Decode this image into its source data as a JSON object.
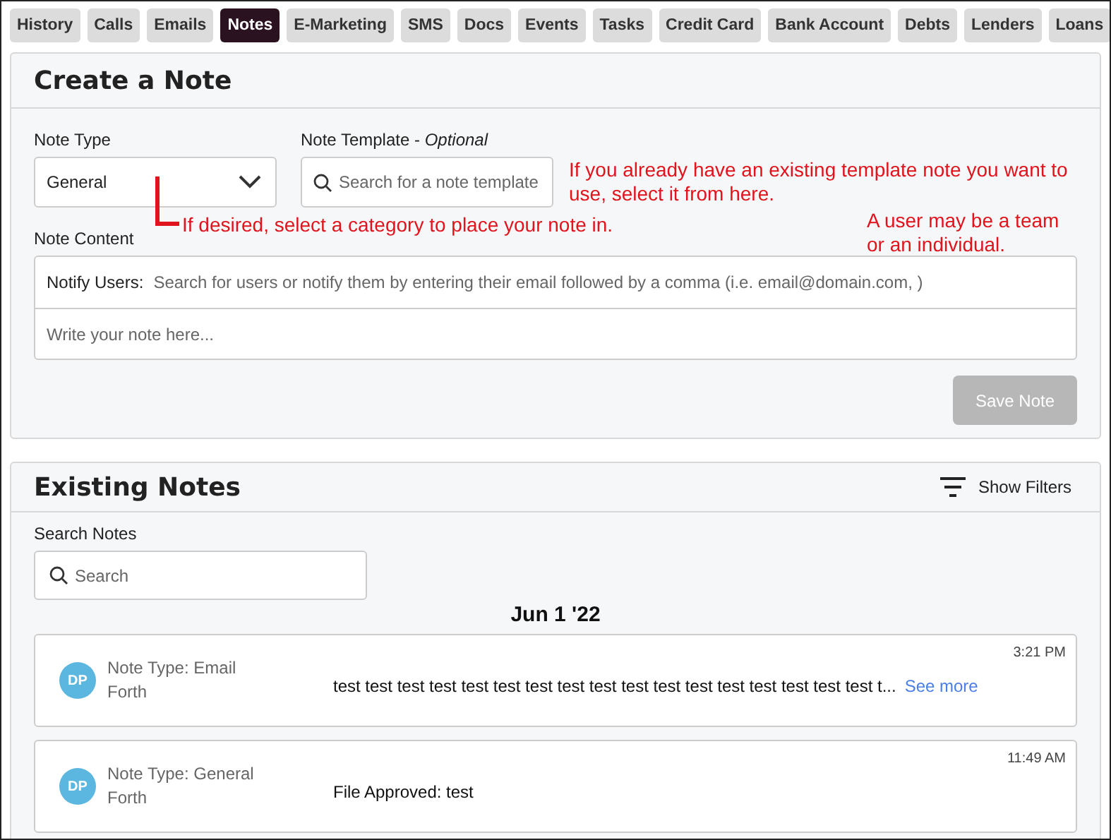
{
  "tabs": [
    {
      "label": "History",
      "selected": false
    },
    {
      "label": "Calls",
      "selected": false
    },
    {
      "label": "Emails",
      "selected": false
    },
    {
      "label": "Notes",
      "selected": true
    },
    {
      "label": "E-Marketing",
      "selected": false
    },
    {
      "label": "SMS",
      "selected": false
    },
    {
      "label": "Docs",
      "selected": false
    },
    {
      "label": "Events",
      "selected": false
    },
    {
      "label": "Tasks",
      "selected": false
    },
    {
      "label": "Credit Card",
      "selected": false
    },
    {
      "label": "Bank Account",
      "selected": false
    },
    {
      "label": "Debts",
      "selected": false
    },
    {
      "label": "Lenders",
      "selected": false
    },
    {
      "label": "Loans",
      "selected": false
    }
  ],
  "create_note": {
    "title": "Create a Note",
    "note_type": {
      "label": "Note Type",
      "value": "General"
    },
    "note_template": {
      "label": "Note Template - *Optional*",
      "placeholder": "Search for a note template"
    },
    "note_content": {
      "label": "Note Content",
      "notify_label": "Notify Users:",
      "notify_placeholder": "Search for users or notify them by entering their email followed by a comma (i.e. email@domain.com, )",
      "note_placeholder": "Write your note here..."
    },
    "save_button": {
      "label": "Save Note",
      "disabled": true
    }
  },
  "annotations": [
    {
      "kind": "template",
      "text": "If you already have an existing template note you want to use, select it from here."
    },
    {
      "kind": "type",
      "text": "If desired, select a category to place your note in."
    },
    {
      "kind": "users",
      "text": "A user may be a team or an individual."
    }
  ],
  "existing_notes": {
    "title": "Existing Notes",
    "filter_button": "Show Filters",
    "search_label": "Search Notes",
    "search_placeholder": "Search",
    "date": "Jun 1 '22",
    "notes": [
      {
        "initials": "DP",
        "type_label": "Note Type: Email",
        "author": "Forth",
        "text": "test test test test test test test test test test test test test test test test test t...",
        "see_more": "See more",
        "time": "3:21 PM"
      },
      {
        "initials": "DP",
        "type_label": "Note Type: General",
        "author": "Forth",
        "text": "File Approved: test",
        "time": "11:49 AM"
      }
    ]
  }
}
